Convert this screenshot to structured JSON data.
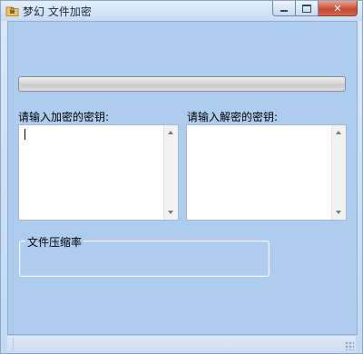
{
  "window": {
    "title": "梦幻 文件加密",
    "icon": "folder-lock-icon",
    "controls": {
      "minimize_icon": "minimize-icon",
      "maximize_icon": "maximize-icon",
      "close_icon": "close-icon",
      "close_glyph": "✕"
    }
  },
  "progress": {
    "value": 0
  },
  "encrypt": {
    "label": "请输入加密的密钥:",
    "value": ""
  },
  "decrypt": {
    "label": "请输入解密的密钥:",
    "value": ""
  },
  "compression": {
    "legend": "文件压缩率"
  },
  "colors": {
    "client_bg": "#aecdee",
    "close_button": "#c7492f",
    "textbox_bg": "#ffffff"
  }
}
